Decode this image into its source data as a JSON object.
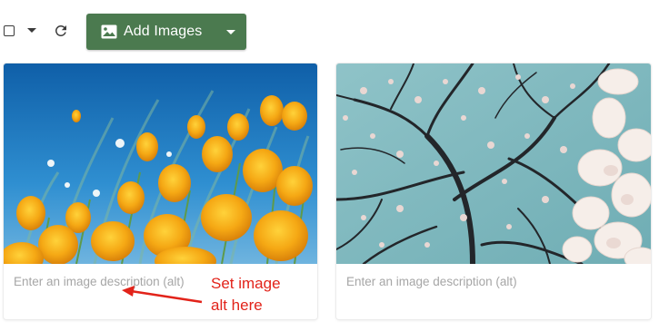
{
  "toolbar": {
    "select_all_checked": false,
    "add_images_label": "Add Images",
    "add_images_color": "#4b7a4f"
  },
  "gallery": {
    "items": [
      {
        "photo_subject": "yellow poppies against blue sky",
        "alt_placeholder": "Enter an image description (alt)",
        "alt_value": ""
      },
      {
        "photo_subject": "blossoming magnolia tree branches against sky",
        "alt_placeholder": "Enter an image description (alt)",
        "alt_value": ""
      }
    ]
  },
  "annotation": {
    "line1": "Set image",
    "line2": "alt here",
    "color": "#e2231a"
  }
}
